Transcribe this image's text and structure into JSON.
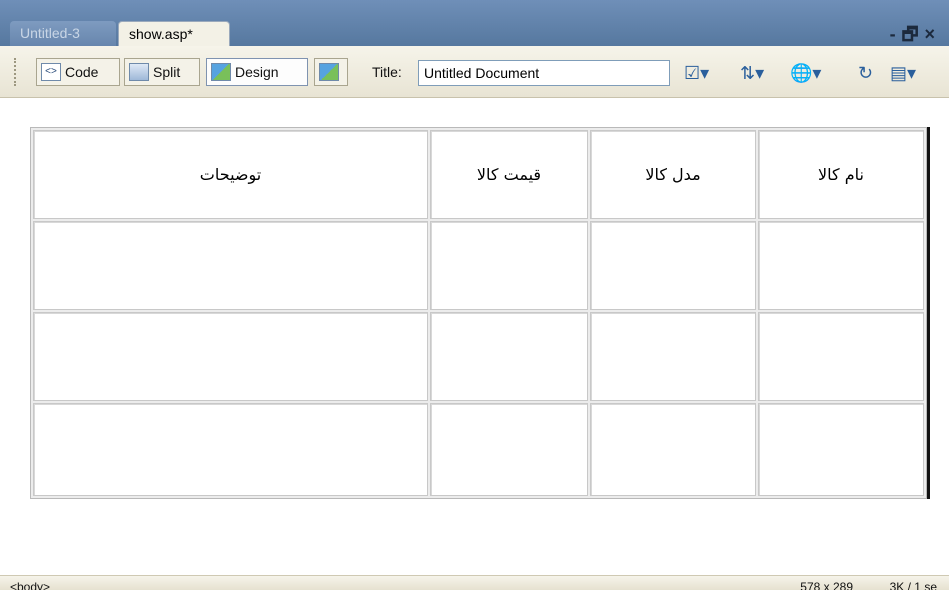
{
  "tabs": [
    {
      "label": "Untitled-3",
      "active": false
    },
    {
      "label": "show.asp*",
      "active": true
    }
  ],
  "window_controls": {
    "minimize": "-",
    "restore": "🗗",
    "close": "×"
  },
  "toolbar": {
    "code_label": "Code",
    "split_label": "Split",
    "design_label": "Design",
    "title_label": "Title:",
    "title_value": "Untitled Document"
  },
  "table": {
    "headers": [
      "نام کالا",
      "مدل کالا",
      "قیمت کالا",
      "توضیحات"
    ],
    "rows": [
      [
        "",
        "",
        "",
        ""
      ],
      [
        "",
        "",
        "",
        ""
      ],
      [
        "",
        "",
        "",
        ""
      ]
    ]
  },
  "statusbar": {
    "tag": "<body>",
    "dimensions": "578 x 289",
    "size": "3K / 1 se"
  },
  "colors": {
    "tabbar": "#5f80a8",
    "toolbar": "#efece0",
    "border": "#c8c8c8"
  },
  "icons": [
    "code-view-icon",
    "split-view-icon",
    "design-view-icon",
    "live-view-icon",
    "validate-icon",
    "file-management-icon",
    "preview-browser-icon",
    "refresh-icon",
    "view-options-icon"
  ]
}
